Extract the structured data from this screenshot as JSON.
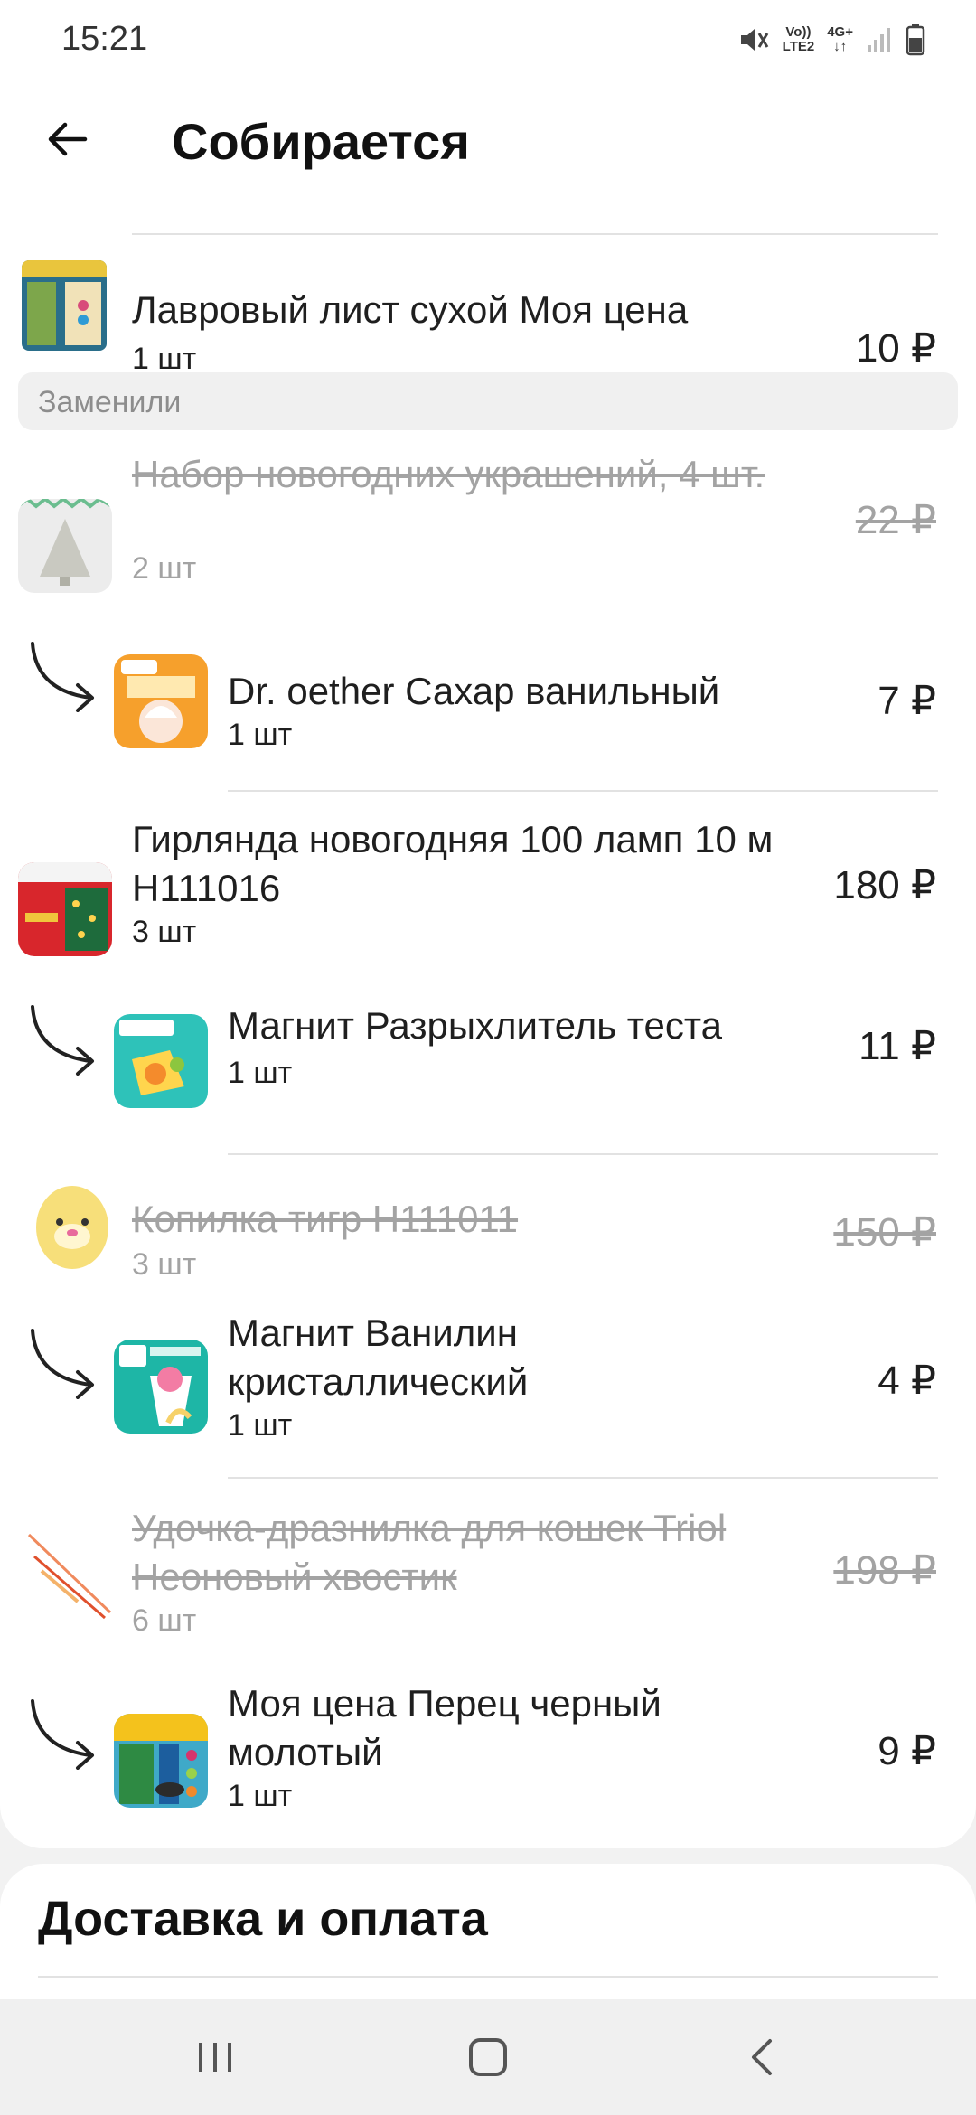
{
  "status_bar": {
    "time": "15:21",
    "network_top": "Vo))",
    "network_bottom": "LTE2",
    "network_4g": "4G+",
    "icons": [
      "mute-icon",
      "signal-icon",
      "battery-icon"
    ]
  },
  "header": {
    "title": "Собирается",
    "back_icon": "arrow-left-icon"
  },
  "items": {
    "first": {
      "name": "Лавровый лист сухой Моя цена",
      "qty": "1 шт",
      "price": "10 ₽"
    },
    "section_label": "Заменили",
    "row1": {
      "name": "Набор новогодних украшений, 4 шт.",
      "qty": "2 шт",
      "price": "22 ₽",
      "status": "removed"
    },
    "row1_replacement": {
      "name": "Dr. oether Сахар ванильный",
      "qty": "1 шт",
      "price": "7 ₽"
    },
    "row2": {
      "name": "Гирлянда новогодняя 100 ламп 10 м Н111016",
      "qty": "3 шт",
      "price": "180 ₽"
    },
    "row2_replacement": {
      "name": "Магнит Разрыхлитель теста",
      "qty": "1 шт",
      "price": "11 ₽"
    },
    "row3": {
      "name": "Копилка тигр Н111011",
      "qty": "3 шт",
      "price": "150 ₽",
      "status": "removed"
    },
    "row3_replacement": {
      "name": "Магнит Ванилин кристаллический",
      "qty": "1 шт",
      "price": "4 ₽"
    },
    "row4": {
      "name": "Удочка-дразнилка для кошек Triol Неоновый хвостик",
      "qty": "6 шт",
      "price": "198 ₽",
      "status": "removed"
    },
    "row4_replacement": {
      "name": "Моя цена Перец черный молотый",
      "qty": "1 шт",
      "price": "9 ₽"
    }
  },
  "delivery": {
    "title": "Доставка и оплата"
  },
  "nav": {
    "icons": [
      "recent-apps-icon",
      "home-icon",
      "back-icon"
    ]
  }
}
